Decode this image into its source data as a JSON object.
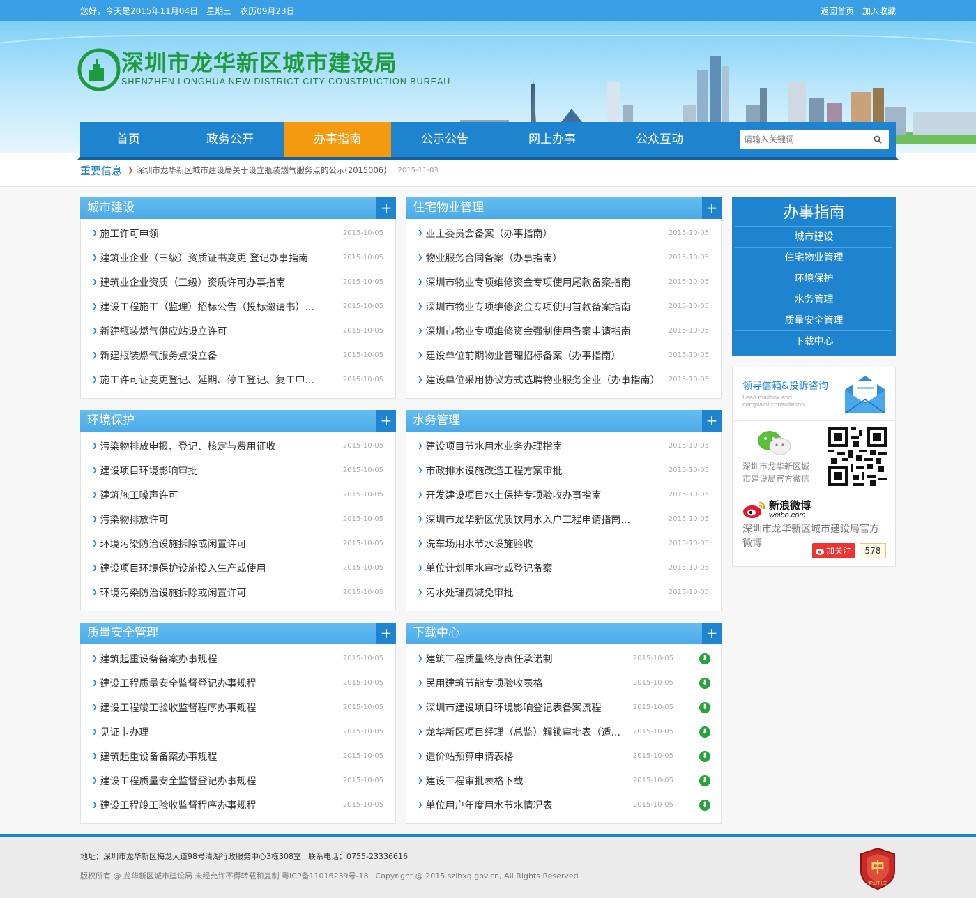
{
  "topbar": {
    "greeting": "您好，今天是2015年11月04日",
    "weekday": "星期三",
    "lunar": "农历09月23日",
    "home": "返回首页",
    "favorite": "加入收藏"
  },
  "header": {
    "title_cn": "深圳市龙华新区城市建设局",
    "title_en": "SHENZHEN  LONGHUA  NEW  DISTRICT  CITY  CONSTRUCTION  BUREAU"
  },
  "nav": {
    "items": [
      "首页",
      "政务公开",
      "办事指南",
      "公示公告",
      "网上办事",
      "公众互动"
    ],
    "active": "办事指南",
    "search_placeholder": "请输入关键词"
  },
  "notice": {
    "label": "重要信息",
    "text": "深圳市龙华新区城市建设局关于设立瓶装燃气服务点的公示(2015006)",
    "date": "2015-11-03"
  },
  "panels": {
    "p1": {
      "title": "城市建设",
      "items": [
        {
          "t": "施工许可申领",
          "d": "2015-10-05"
        },
        {
          "t": "建筑业企业（三级）资质证书变更 登记办事指南",
          "d": "2015-10-05"
        },
        {
          "t": "建筑业企业资质（三级）资质许可办事指南",
          "d": "2015-10-05"
        },
        {
          "t": "建设工程施工（监理）招标公告（投标邀请书）...",
          "d": "2015-10-05"
        },
        {
          "t": "新建瓶装燃气供应站设立许可",
          "d": "2015-10-05"
        },
        {
          "t": "新建瓶装燃气服务点设立备",
          "d": "2015-10-05"
        },
        {
          "t": "施工许可证变更登记、延期、停工登记、复工申...",
          "d": "2015-10-05"
        }
      ]
    },
    "p2": {
      "title": "住宅物业管理",
      "items": [
        {
          "t": "业主委员会备案（办事指南）",
          "d": "2015-10-05"
        },
        {
          "t": "物业服务合同备案（办事指南）",
          "d": "2015-10-05"
        },
        {
          "t": "深圳市物业专项维修资金专项使用尾款备案指南",
          "d": "2015-10-05"
        },
        {
          "t": "深圳市物业专项维修资金专项使用首款备案指南",
          "d": "2015-10-05"
        },
        {
          "t": "深圳市物业专项维修资金强制使用备案申请指南",
          "d": "2015-10-05"
        },
        {
          "t": "建设单位前期物业管理招标备案（办事指南）",
          "d": "2015-10-05"
        },
        {
          "t": "建设单位采用协议方式选聘物业服务企业（办事指南）",
          "d": "2015-10-05"
        }
      ]
    },
    "p3": {
      "title": "环境保护",
      "items": [
        {
          "t": "污染物排放申报、登记、核定与费用征收",
          "d": "2015-10-05"
        },
        {
          "t": "建设项目环境影响审批",
          "d": "2015-10-05"
        },
        {
          "t": "建筑施工噪声许可",
          "d": "2015-10-05"
        },
        {
          "t": "污染物排放许可",
          "d": "2015-10-05"
        },
        {
          "t": "环境污染防治设施拆除或闲置许可",
          "d": "2015-10-05"
        },
        {
          "t": "建设项目环境保护设施投入生产或使用",
          "d": "2015-10-05"
        },
        {
          "t": "环境污染防治设施拆除或闲置许可",
          "d": "2015-10-05"
        }
      ]
    },
    "p4": {
      "title": "水务管理",
      "items": [
        {
          "t": "建设项目节水用水业务办理指南",
          "d": "2015-10-05"
        },
        {
          "t": "市政排水设施改造工程方案审批",
          "d": "2015-10-05"
        },
        {
          "t": "开发建设项目水土保持专项验收办事指南",
          "d": "2015-10-05"
        },
        {
          "t": "深圳市龙华新区优质饮用水入户工程申请指南...",
          "d": "2015-10-05"
        },
        {
          "t": "洗车场用水节水设施验收",
          "d": "2015-10-05"
        },
        {
          "t": "单位计划用水审批或登记备案",
          "d": "2015-10-05"
        },
        {
          "t": "污水处理费减免审批",
          "d": "2015-10-05"
        }
      ]
    },
    "p5": {
      "title": "质量安全管理",
      "items": [
        {
          "t": "建筑起重设备备案办事规程",
          "d": "2015-10-05"
        },
        {
          "t": "建设工程质量安全监督登记办事规程",
          "d": "2015-10-05"
        },
        {
          "t": "建设工程竣工验收监督程序办事规程",
          "d": "2015-10-05"
        },
        {
          "t": "见证卡办理",
          "d": "2015-10-05"
        },
        {
          "t": "建筑起重设备备案办事规程",
          "d": "2015-10-05"
        },
        {
          "t": "建设工程质量安全监督登记办事规程",
          "d": "2015-10-05"
        },
        {
          "t": "建设工程竣工验收监督程序办事规程",
          "d": "2015-10-05"
        }
      ]
    },
    "p6": {
      "title": "下载中心",
      "items": [
        {
          "t": "建筑工程质量终身责任承诺制",
          "d": "2015-10-05"
        },
        {
          "t": "民用建筑节能专项验收表格",
          "d": "2015-10-05"
        },
        {
          "t": "深圳市建设项目环境影响登记表备案流程",
          "d": "2015-10-05"
        },
        {
          "t": "龙华新区项目经理（总监）解锁审批表（适...",
          "d": "2015-10-05"
        },
        {
          "t": "造价站预算申请表格",
          "d": "2015-10-05"
        },
        {
          "t": "建设工程审批表格下载",
          "d": "2015-10-05"
        },
        {
          "t": "单位用户年度用水节水情况表",
          "d": "2015-10-05"
        }
      ]
    }
  },
  "sidebar": {
    "guide_title": "办事指南",
    "guide_items": [
      "城市建设",
      "住宅物业管理",
      "环境保护",
      "水务管理",
      "质量安全管理",
      "下载中心"
    ],
    "mail_title": "领导信箱&投诉咨询",
    "mail_sub1": "Lead mailbox and",
    "mail_sub2": "complaint consultation",
    "wechat_text": "深圳市龙华新区城市建设局官方微信",
    "weibo_logo_cn": "新浪微博",
    "weibo_logo_en": "weibo.com",
    "weibo_name": "深圳市龙华新区城市建设局官方微博",
    "follow_label": "加关注",
    "follow_count": "578"
  },
  "footer": {
    "address": "地址：深圳市龙华新区梅龙大道98号清湖行政服务中心3栋308室",
    "phone": "联系电话：0755-23336616",
    "copyright": "版权所有 @ 龙华新区城市建设局  未经允许不得转载和复制  粤ICP备11016239号-18",
    "copyright_en": "Copyright @ 2015 szlhxq.gov.cn, All Rights Reserved",
    "emblem_text": "党政机关"
  }
}
